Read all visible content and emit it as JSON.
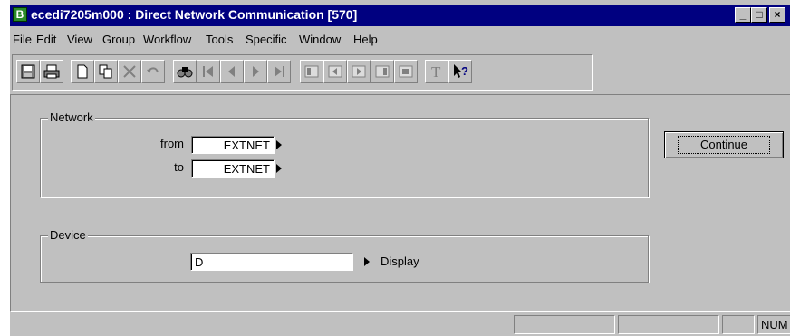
{
  "window": {
    "title": "ecedi7205m000 : Direct Network Communication [570]",
    "app_icon_glyph": "B",
    "controls": [
      "_",
      "□",
      "×"
    ]
  },
  "menu": [
    "File",
    "Edit",
    "View",
    "Group",
    "Workflow",
    "Tools",
    "Specific",
    "Window",
    "Help"
  ],
  "toolbar": {
    "icons": [
      "save-icon",
      "print-icon",
      "new-icon",
      "copy-icon",
      "delete-icon",
      "undo-icon",
      "find-icon",
      "first-record-icon",
      "previous-record-icon",
      "next-record-icon",
      "last-record-icon",
      "group-first-icon",
      "group-previous-icon",
      "group-next-icon",
      "group-last-icon",
      "text-icon",
      "help-pointer-icon"
    ],
    "text_glyph": "T"
  },
  "network": {
    "legend": "Network",
    "from_label": "from",
    "from_value": "EXTNET",
    "to_label": "to",
    "to_value": "EXTNET"
  },
  "device": {
    "legend": "Device",
    "value": "D",
    "description": "Display"
  },
  "continue_label": "Continue",
  "status": {
    "panes": [
      "",
      "",
      "",
      "",
      "NUM"
    ]
  }
}
